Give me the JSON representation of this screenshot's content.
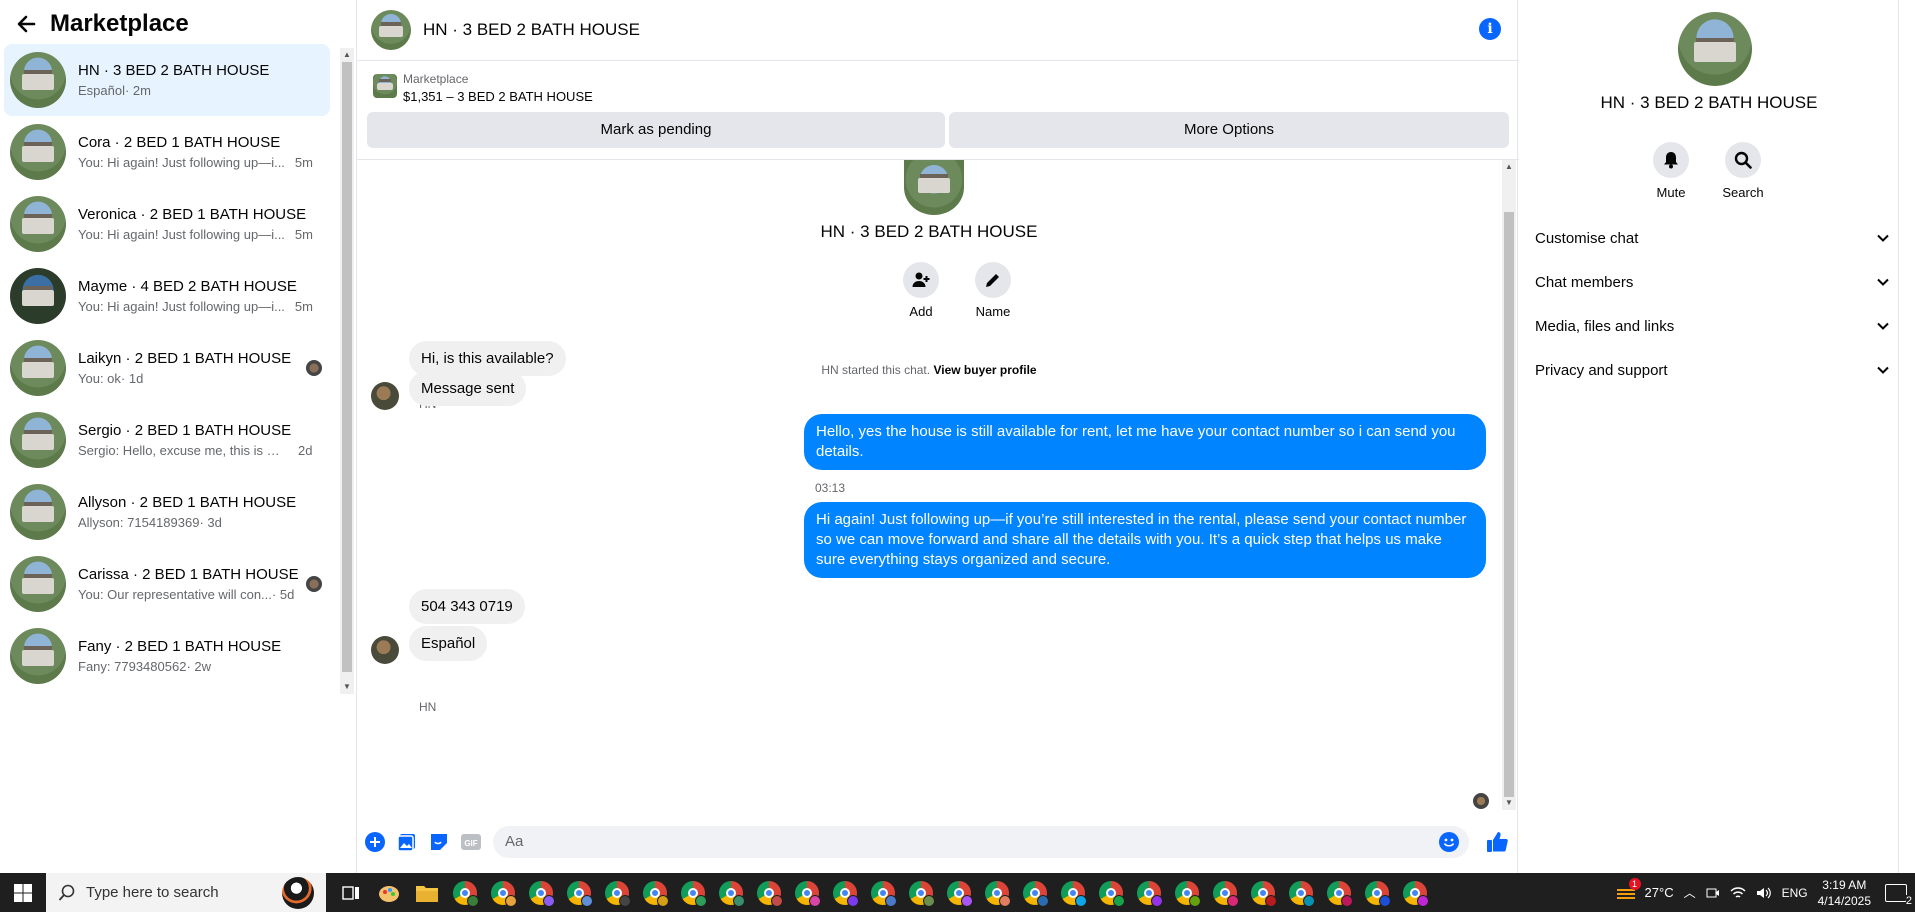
{
  "sidebar": {
    "title": "Marketplace",
    "conversations": [
      {
        "name": "HN · 3 BED 2 BATH HOUSE",
        "snippet": "Español",
        "time": "· 2m",
        "active": true
      },
      {
        "name": "Cora · 2 BED 1 BATH HOUSE",
        "snippet": "You: Hi again! Just following up—i...",
        "time": "5m"
      },
      {
        "name": "Veronica · 2 BED 1 BATH HOUSE",
        "snippet": "You: Hi again! Just following up—i...",
        "time": "5m"
      },
      {
        "name": "Mayme · 4 BED 2 BATH HOUSE",
        "snippet": "You: Hi again! Just following up—i...",
        "time": "5m"
      },
      {
        "name": "Laikyn · 2 BED 1 BATH HOUSE",
        "snippet": "You: ok",
        "time": "· 1d"
      },
      {
        "name": "Sergio · 2 BED 1 BATH HOUSE",
        "snippet": "Sergio: Hello, excuse me, this is my...",
        "time": "2d"
      },
      {
        "name": "Allyson · 2 BED 1 BATH HOUSE",
        "snippet": "Allyson: 7154189369",
        "time": "· 3d"
      },
      {
        "name": "Carissa · 2 BED 1 BATH HOUSE",
        "snippet": "You: Our representative will con...",
        "time": "· 5d"
      },
      {
        "name": "Fany · 2 BED 1 BATH HOUSE",
        "snippet": "Fany: 7793480562",
        "time": "· 2w"
      }
    ]
  },
  "chat": {
    "title": "HN · 3 BED 2 BATH HOUSE",
    "listing": {
      "kind": "Marketplace",
      "price_line": "$1,351 – 3 BED 2 BATH HOUSE",
      "pending_label": "Mark as pending",
      "more_label": "More Options"
    },
    "intro": {
      "title": "HN · 3 BED 2 BATH HOUSE",
      "add_label": "Add",
      "name_label": "Name",
      "started_text": "HN started this chat.",
      "profile_link": "View buyer profile"
    },
    "messages": {
      "sender1": "HN",
      "in1": "Hi, is this available?",
      "in2": "Message sent",
      "out1": "Hello, yes the house is still available for rent, let me have your contact number so i can send you details.",
      "time1": "03:13",
      "out2": "Hi again! Just following up—if you’re still interested in the rental, please send your contact number so we can move forward and share all the details with you. It’s a quick step that helps us make sure everything stays organized and secure.",
      "sender2": "HN",
      "in3": "504 343 0719",
      "in4": "Español"
    },
    "composer": {
      "placeholder": "Aa",
      "gif_label": "GIF"
    }
  },
  "panel": {
    "title": "HN · 3 BED 2 BATH HOUSE",
    "mute_label": "Mute",
    "search_label": "Search",
    "sections": [
      "Customise chat",
      "Chat members",
      "Media, files and links",
      "Privacy and support"
    ]
  },
  "taskbar": {
    "search_placeholder": "Type here to search",
    "weather": "27°C",
    "weather_badge": "1",
    "language": "ENG",
    "time": "3:19 AM",
    "date": "4/14/2025",
    "notification_count": "2"
  },
  "colors": {
    "accent": "#0866ff",
    "outgoing_bubble": "#0084ff",
    "incoming_bubble": "#f0f0f0",
    "active_row": "#e7f3ff"
  }
}
